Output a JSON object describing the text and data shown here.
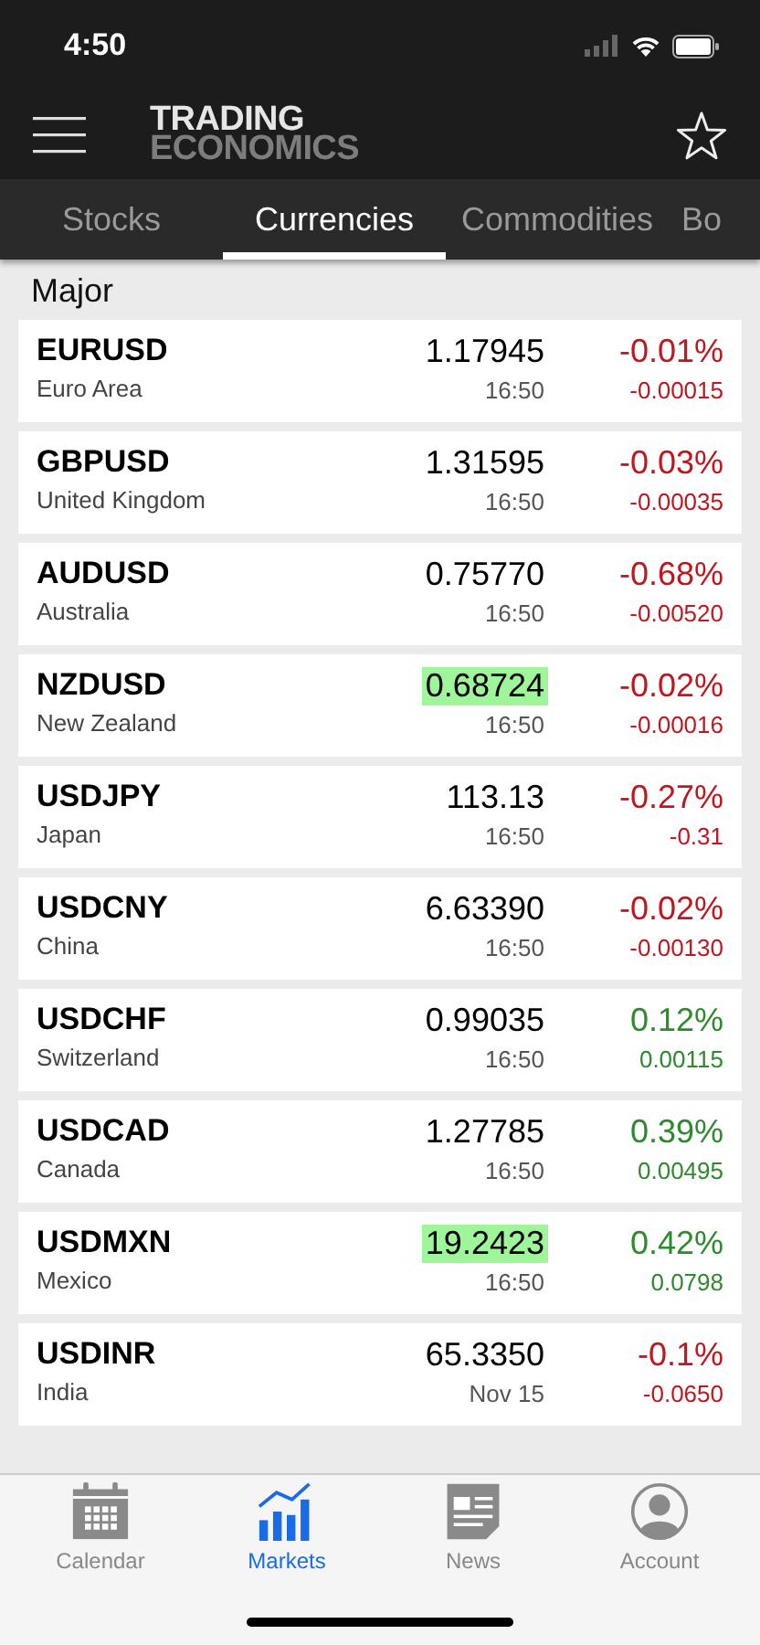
{
  "status_bar": {
    "time": "4:50"
  },
  "header": {
    "logo_top": "TRADING",
    "logo_bottom": "ECONOMICS"
  },
  "tabs": [
    {
      "label": "Stocks",
      "selected": false
    },
    {
      "label": "Currencies",
      "selected": true
    },
    {
      "label": "Commodities",
      "selected": false
    },
    {
      "label": "Bo",
      "selected": false
    }
  ],
  "section": "Major",
  "rows": [
    {
      "symbol": "EURUSD",
      "country": "Euro Area",
      "price": "1.17945",
      "time": "16:50",
      "percent": "-0.01%",
      "change": "-0.00015",
      "highlighted": false,
      "color": "#c0171f"
    },
    {
      "symbol": "GBPUSD",
      "country": "United Kingdom",
      "price": "1.31595",
      "time": "16:50",
      "percent": "-0.03%",
      "change": "-0.00035",
      "highlighted": false,
      "color": "#c0171f"
    },
    {
      "symbol": "AUDUSD",
      "country": "Australia",
      "price": "0.75770",
      "time": "16:50",
      "percent": "-0.68%",
      "change": "-0.00520",
      "highlighted": false,
      "color": "#c0171f"
    },
    {
      "symbol": "NZDUSD",
      "country": "New Zealand",
      "price": "0.68724",
      "time": "16:50",
      "percent": "-0.02%",
      "change": "-0.00016",
      "highlighted": true,
      "color": "#c0171f"
    },
    {
      "symbol": "USDJPY",
      "country": "Japan",
      "price": "113.13",
      "time": "16:50",
      "percent": "-0.27%",
      "change": "-0.31",
      "highlighted": false,
      "color": "#c0171f"
    },
    {
      "symbol": "USDCNY",
      "country": "China",
      "price": "6.63390",
      "time": "16:50",
      "percent": "-0.02%",
      "change": "-0.00130",
      "highlighted": false,
      "color": "#c0171f"
    },
    {
      "symbol": "USDCHF",
      "country": "Switzerland",
      "price": "0.99035",
      "time": "16:50",
      "percent": "0.12%",
      "change": "0.00115",
      "highlighted": false,
      "color": "#2d8a2d"
    },
    {
      "symbol": "USDCAD",
      "country": "Canada",
      "price": "1.27785",
      "time": "16:50",
      "percent": "0.39%",
      "change": "0.00495",
      "highlighted": false,
      "color": "#2d8a2d"
    },
    {
      "symbol": "USDMXN",
      "country": "Mexico",
      "price": "19.2423",
      "time": "16:50",
      "percent": "0.42%",
      "change": "0.0798",
      "highlighted": true,
      "color": "#2d8a2d"
    },
    {
      "symbol": "USDINR",
      "country": "India",
      "price": "65.3350",
      "time": "Nov 15",
      "percent": "-0.1%",
      "change": "-0.0650",
      "highlighted": false,
      "color": "#c0171f"
    }
  ],
  "bottom_nav": [
    {
      "kind": "calendar",
      "label": "Calendar",
      "selected": false
    },
    {
      "kind": "markets",
      "label": "Markets",
      "selected": true
    },
    {
      "kind": "news",
      "label": "News",
      "selected": false
    },
    {
      "kind": "account",
      "label": "Account",
      "selected": false
    }
  ]
}
